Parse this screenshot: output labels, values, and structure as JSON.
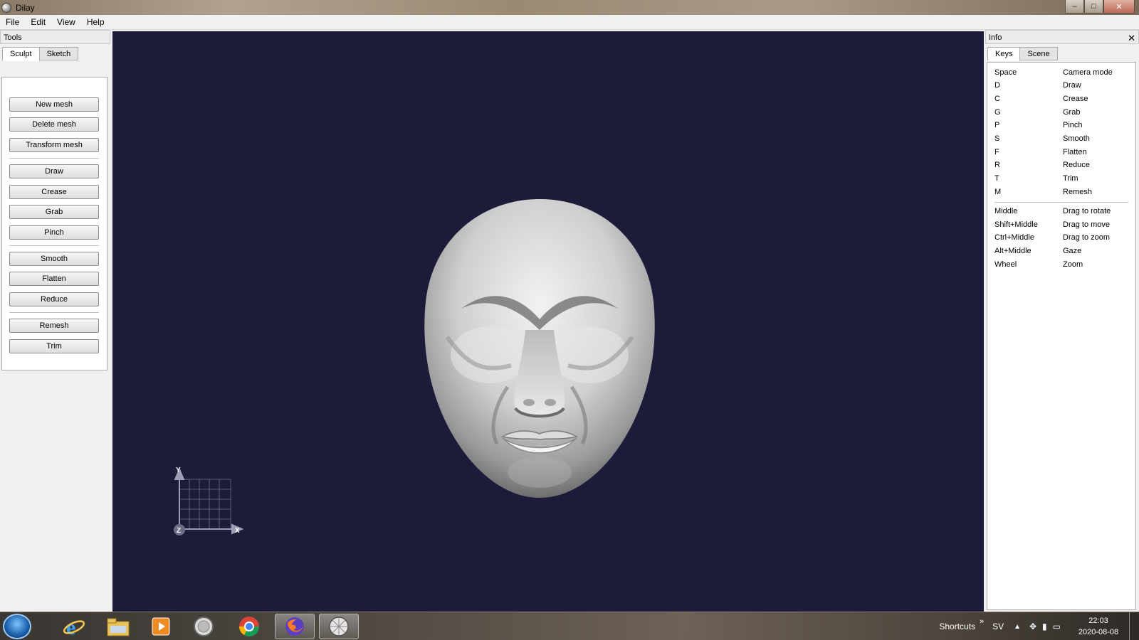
{
  "window": {
    "title": "Dilay",
    "controls": {
      "minimize": "–",
      "maximize": "□",
      "close": "✕"
    }
  },
  "menu": [
    "File",
    "Edit",
    "View",
    "Help"
  ],
  "tools": {
    "title": "Tools",
    "tabs": [
      "Sculpt",
      "Sketch"
    ],
    "buttons": [
      "New mesh",
      "Delete mesh",
      "Transform mesh",
      "Draw",
      "Crease",
      "Grab",
      "Pinch",
      "Smooth",
      "Flatten",
      "Reduce",
      "Remesh",
      "Trim"
    ]
  },
  "viewport": {
    "background": "#1c1b39",
    "axis_labels": {
      "y": "Y",
      "x": "X",
      "z": "Z"
    }
  },
  "info": {
    "title": "Info",
    "close": "✕",
    "tabs": [
      "Keys",
      "Scene"
    ],
    "keys": [
      {
        "key": "Space",
        "action": "Camera mode"
      },
      {
        "key": "D",
        "action": "Draw"
      },
      {
        "key": "C",
        "action": "Crease"
      },
      {
        "key": "G",
        "action": "Grab"
      },
      {
        "key": "P",
        "action": "Pinch"
      },
      {
        "key": "S",
        "action": "Smooth"
      },
      {
        "key": "F",
        "action": "Flatten"
      },
      {
        "key": "R",
        "action": "Reduce"
      },
      {
        "key": "T",
        "action": "Trim"
      },
      {
        "key": "M",
        "action": "Remesh"
      }
    ],
    "mouse": [
      {
        "key": "Middle",
        "action": "Drag to rotate"
      },
      {
        "key": "Shift+Middle",
        "action": "Drag to move"
      },
      {
        "key": "Ctrl+Middle",
        "action": "Drag to zoom"
      },
      {
        "key": "Alt+Middle",
        "action": "Gaze"
      },
      {
        "key": "Wheel",
        "action": "Zoom"
      }
    ]
  },
  "taskbar": {
    "apps": [
      "internet-explorer-icon",
      "file-explorer-icon",
      "media-player-icon",
      "circle-app-icon",
      "chrome-icon",
      "firefox-icon",
      "dilay-icon"
    ],
    "shortcuts": "Shortcuts",
    "shortcuts_chevron": "»",
    "language": "SV",
    "time": "22:03",
    "date": "2020-08-08"
  }
}
